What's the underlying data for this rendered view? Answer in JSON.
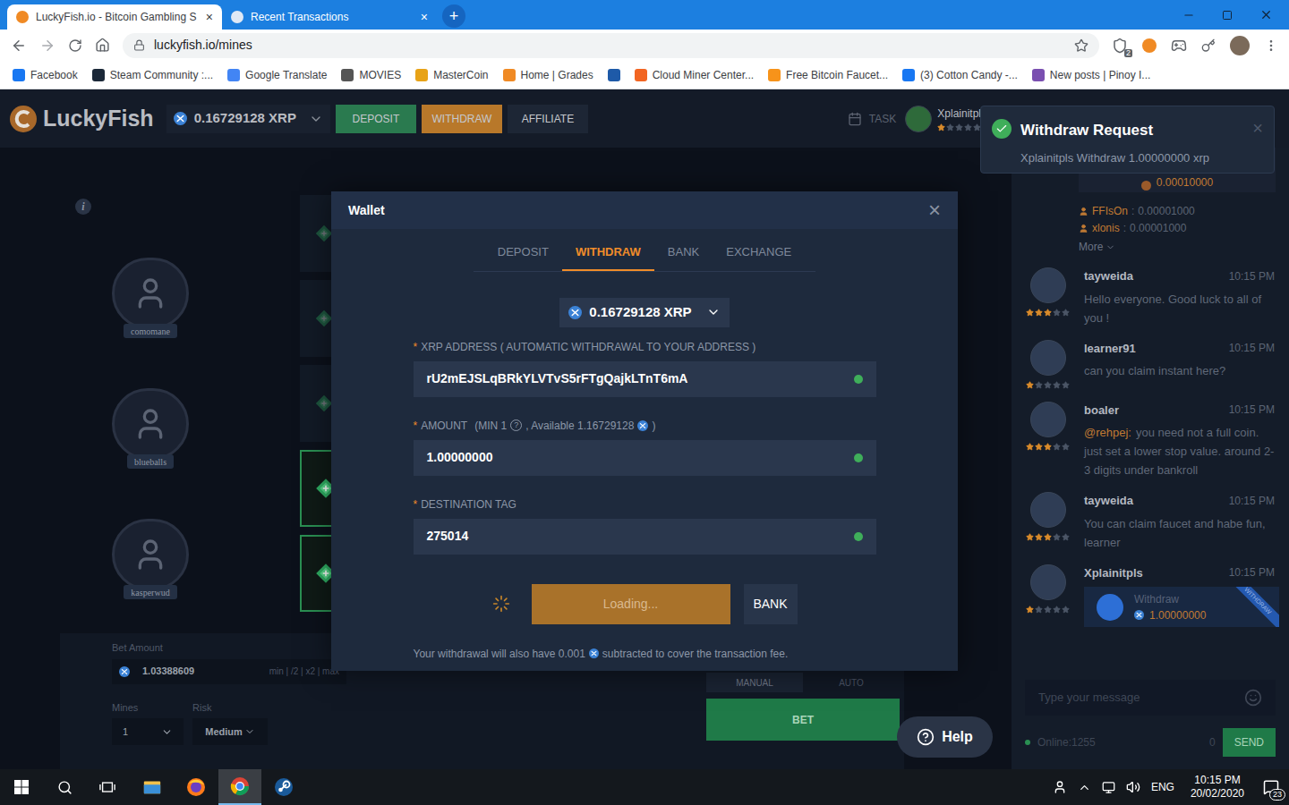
{
  "browser": {
    "tabs": [
      {
        "label": "LuckyFish.io - Bitcoin Gambling S",
        "selected": true,
        "close": "×"
      },
      {
        "label": "Recent Transactions",
        "selected": false,
        "close": "×"
      }
    ],
    "new_tab": "+",
    "url": "luckyfish.io/mines",
    "extension_badge": "2",
    "bookmarks": [
      {
        "label": "Facebook",
        "color": "#1877f2"
      },
      {
        "label": "Steam Community :...",
        "color": "#1b2838"
      },
      {
        "label": "Google Translate",
        "color": "#4285f4"
      },
      {
        "label": "MOVIES",
        "color": "#555555"
      },
      {
        "label": "MasterCoin",
        "color": "#e8a317"
      },
      {
        "label": "Home | Grades",
        "color": "#f08a24"
      },
      {
        "label": "",
        "color": "#1e5aa8"
      },
      {
        "label": "Cloud Miner Center...",
        "color": "#f26522"
      },
      {
        "label": "Free Bitcoin Faucet...",
        "color": "#f7931a"
      },
      {
        "label": "(3) Cotton Candy -...",
        "color": "#1877f2"
      },
      {
        "label": "New posts | Pinoy I...",
        "color": "#7a4fb0"
      }
    ]
  },
  "site": {
    "logo": "LuckyFish",
    "balance": "0.16729128 XRP",
    "nav": [
      {
        "label": "DEPOSIT",
        "color": "#2a7a4f"
      },
      {
        "label": "WITHDRAW",
        "color": "#b8782a"
      },
      {
        "label": "AFFILIATE",
        "color": "#1d2635"
      }
    ],
    "task": "TASK",
    "user": {
      "name": "Xplainitpls",
      "caret": "▾",
      "stars": 1
    }
  },
  "game": {
    "info": "i",
    "players": [
      {
        "name": "comomane"
      },
      {
        "name": "blueballs"
      },
      {
        "name": "kasperwud"
      }
    ],
    "board": [
      {
        "revealed": false
      },
      {
        "revealed": false
      },
      {
        "revealed": false
      },
      {
        "revealed": true
      },
      {
        "revealed": true
      }
    ],
    "bet_label": "Bet Amount",
    "bet_value": "1.03388609",
    "bet_actions": "min | /2 | x2 | max",
    "mines_label": "Mines",
    "mines_value": "1",
    "risk_label": "Risk",
    "risk_value": "Medium",
    "modes": [
      {
        "label": "MANUAL",
        "selected": true
      },
      {
        "label": "AUTO",
        "selected": false
      }
    ],
    "bet_button": "BET"
  },
  "chat": {
    "top_win": "0.00010000",
    "separator": ":",
    "tips": [
      {
        "user": "FFIsOn",
        "amount": "0.00001000"
      },
      {
        "user": "xlonis",
        "amount": "0.00001000"
      }
    ],
    "more": "More",
    "messages": [
      {
        "kind": "text",
        "user": "tayweida",
        "time": "10:15 PM",
        "stars": 3,
        "mention": "",
        "text": "Hello everyone. Good luck to all of you !",
        "card_label": "",
        "card_amount": "",
        "ribbon": ""
      },
      {
        "kind": "text",
        "user": "learner91",
        "time": "10:15 PM",
        "stars": 1,
        "mention": "",
        "text": "can you claim instant here?",
        "card_label": "",
        "card_amount": "",
        "ribbon": ""
      },
      {
        "kind": "text",
        "user": "boaler",
        "time": "10:15 PM",
        "stars": 3,
        "mention": "@rehpej:",
        "text": "you need not a full coin. just set a lower stop value. around 2-3 digits under bankroll",
        "card_label": "",
        "card_amount": "",
        "ribbon": ""
      },
      {
        "kind": "text",
        "user": "tayweida",
        "time": "10:15 PM",
        "stars": 3,
        "mention": "",
        "text": "You can claim faucet and habe fun, learner",
        "card_label": "",
        "card_amount": "",
        "ribbon": ""
      },
      {
        "kind": "withdraw",
        "user": "Xplainitpls",
        "time": "10:15 PM",
        "stars": 1,
        "mention": "",
        "text": "",
        "card_label": "Withdraw",
        "card_amount": "1.00000000",
        "ribbon": "WITHDRAW"
      }
    ],
    "placeholder": "Type your message",
    "online": "Online:1255",
    "count": "0",
    "send": "SEND"
  },
  "toast": {
    "title": "Withdraw Request",
    "message": "Xplainitpls Withdraw 1.00000000 xrp",
    "close": "×"
  },
  "wallet": {
    "title": "Wallet",
    "close": "×",
    "tabs": [
      {
        "label": "DEPOSIT",
        "selected": false
      },
      {
        "label": "WITHDRAW",
        "selected": true
      },
      {
        "label": "BANK",
        "selected": false
      },
      {
        "label": "EXCHANGE",
        "selected": false
      }
    ],
    "currency": "0.16729128 XRP",
    "required": "*",
    "address_label": "XRP ADDRESS ( AUTOMATIC WITHDRAWAL TO YOUR ADDRESS )",
    "address_value": "rU2mEJSLqBRkYLVTvS5rFTgQajkLTnT6mA",
    "address_valid": true,
    "amount_label": "AMOUNT",
    "amount_min": "(MIN 1",
    "amount_help": "?",
    "amount_available": ", Available 1.16729128",
    "amount_close": ")",
    "amount_value": "1.00000000",
    "amount_valid": true,
    "tag_label": "DESTINATION TAG",
    "tag_value": "275014",
    "tag_valid": true,
    "submit": "Loading...",
    "loading": true,
    "bank": "BANK",
    "fee_before": "Your withdrawal will also have 0.001",
    "fee_after": "subtracted to cover the transaction fee."
  },
  "help": "Help",
  "taskbar": {
    "apps": [
      {
        "kind": "explorer",
        "selected": false
      },
      {
        "kind": "firefox",
        "selected": false
      },
      {
        "kind": "chrome",
        "selected": true
      },
      {
        "kind": "steam",
        "selected": false
      }
    ],
    "lang": "ENG",
    "time": "10:15 PM",
    "date": "20/02/2020",
    "notifications": "23"
  }
}
